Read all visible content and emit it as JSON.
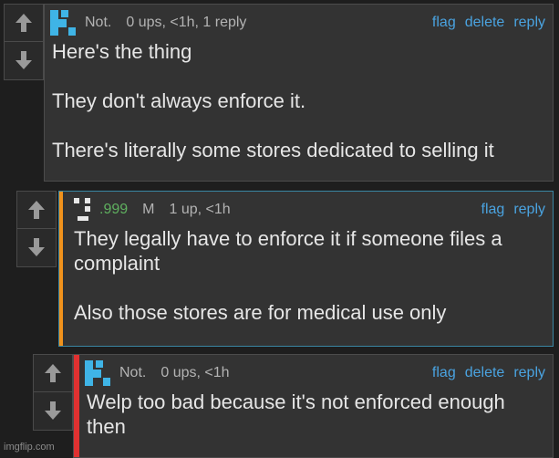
{
  "comments": [
    {
      "username": "Not.",
      "stats": "0 ups, <1h, 1 reply",
      "actions": [
        "flag",
        "delete",
        "reply"
      ],
      "paragraphs": [
        "Here's the thing",
        "They don't always enforce it.",
        "There's literally some stores dedicated to selling it"
      ],
      "avatar_color": "#3fb4e6"
    },
    {
      "username": ".999",
      "badge": "M",
      "stats": "1 up, <1h",
      "actions": [
        "flag",
        "reply"
      ],
      "paragraphs": [
        "They legally have to enforce it if someone files a complaint",
        "Also those stores are for medical use only"
      ],
      "bar_color": "#f0921c",
      "avatar_color": "#e8e8e8"
    },
    {
      "username": "Not.",
      "stats": "0 ups, <1h",
      "actions": [
        "flag",
        "delete",
        "reply"
      ],
      "paragraphs": [
        "Welp too bad because it's not enforced enough then"
      ],
      "bar_color": "#e03131",
      "avatar_color": "#3fb4e6"
    }
  ],
  "watermark": "imgflip.com"
}
